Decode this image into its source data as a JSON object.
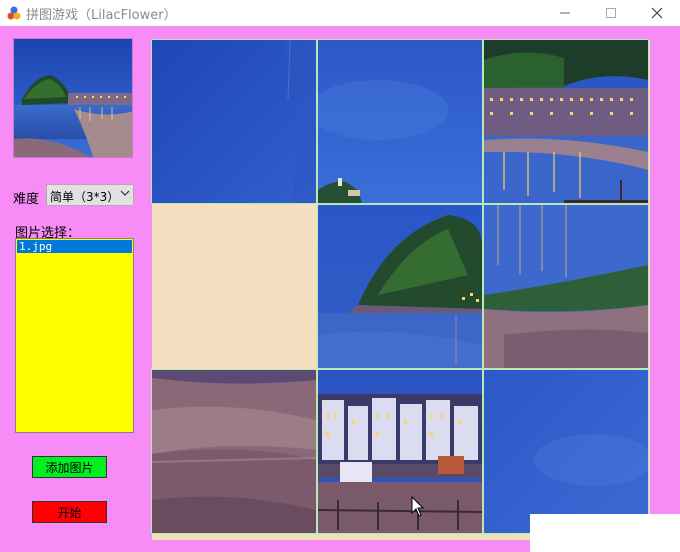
{
  "window": {
    "title": "拼图游戏（LilacFlower）",
    "icon": "puzzle-app-icon",
    "controls": {
      "minimize": "minimize-icon",
      "maximize": "maximize-icon",
      "close": "close-icon"
    }
  },
  "sidebar": {
    "preview_image": "lighthouse-cliff-coastal-town",
    "difficulty_label": "难度",
    "difficulty_value": "简单（3*3）",
    "image_select_label": "图片选择：",
    "image_list": [
      "1.jpg"
    ],
    "selected_index": 0,
    "add_button_label": "添加图片",
    "start_button_label": "开始"
  },
  "puzzle": {
    "grid": "3x3",
    "empty_tile_index": 3,
    "tiles": [
      "blue-sky-left",
      "blue-sky-with-lighthouse-tip",
      "town-lights-top-right",
      "empty",
      "cliff-headland",
      "bay-with-pier",
      "sandy-beach",
      "seafront-buildings",
      "plain-blue-sky"
    ]
  },
  "colors": {
    "client_background": "#f78cf7",
    "listbox_background": "#ffff00",
    "selection": "#0078d7",
    "add_button": "#00ee22",
    "start_button": "#ff0000",
    "empty_tile": "#f4e0c0",
    "tile_border": "#b9e7b8"
  }
}
